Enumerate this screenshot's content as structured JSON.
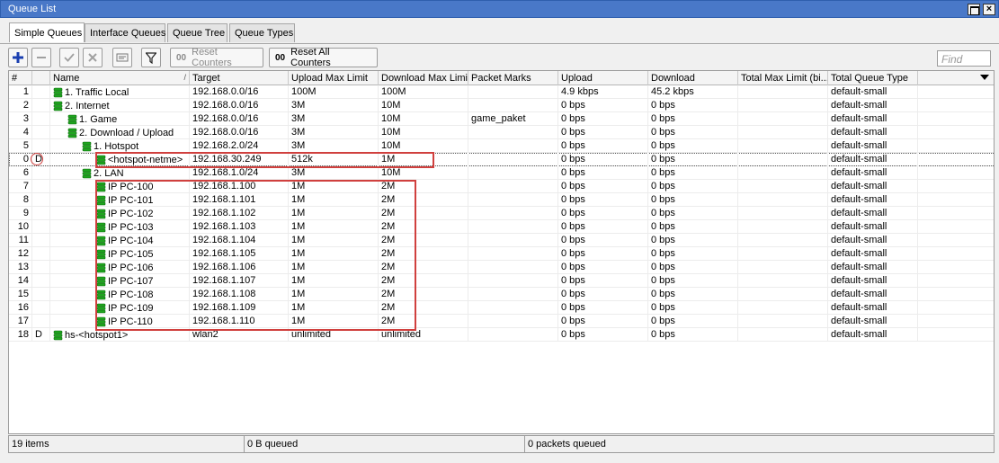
{
  "window": {
    "title": "Queue List"
  },
  "tabs": [
    {
      "label": "Simple Queues",
      "active": true
    },
    {
      "label": "Interface Queues",
      "active": false
    },
    {
      "label": "Queue Tree",
      "active": false
    },
    {
      "label": "Queue Types",
      "active": false
    }
  ],
  "toolbar": {
    "add_icon": "plus-icon",
    "remove_icon": "minus-icon",
    "enable_icon": "check-icon",
    "disable_icon": "x-icon",
    "comment_icon": "note-icon",
    "filter_icon": "filter-icon",
    "reset_counters_label": "Reset Counters",
    "reset_all_counters_label": "Reset All Counters",
    "counter_prefix": "00",
    "find_placeholder": "Find"
  },
  "columns": [
    "#",
    "Name",
    "Target",
    "Upload Max Limit",
    "Download Max Limit",
    "Packet Marks",
    "Upload",
    "Download",
    "Total Max Limit (bi...",
    "Total Queue Type"
  ],
  "sort_mark": "/",
  "rows": [
    {
      "num": "1",
      "flag": "",
      "level": 0,
      "name": "1. Traffic Local",
      "target": "192.168.0.0/16",
      "upmax": "100M",
      "downmax": "100M",
      "marks": "",
      "upload": "4.9 kbps",
      "download": "45.2 kbps",
      "totmax": "",
      "type": "default-small"
    },
    {
      "num": "2",
      "flag": "",
      "level": 0,
      "name": "2. Internet",
      "target": "192.168.0.0/16",
      "upmax": "3M",
      "downmax": "10M",
      "marks": "",
      "upload": "0 bps",
      "download": "0 bps",
      "totmax": "",
      "type": "default-small"
    },
    {
      "num": "3",
      "flag": "",
      "level": 1,
      "name": "1. Game",
      "target": "192.168.0.0/16",
      "upmax": "3M",
      "downmax": "10M",
      "marks": "game_paket",
      "upload": "0 bps",
      "download": "0 bps",
      "totmax": "",
      "type": "default-small"
    },
    {
      "num": "4",
      "flag": "",
      "level": 1,
      "name": "2. Download / Upload",
      "target": "192.168.0.0/16",
      "upmax": "3M",
      "downmax": "10M",
      "marks": "",
      "upload": "0 bps",
      "download": "0 bps",
      "totmax": "",
      "type": "default-small"
    },
    {
      "num": "5",
      "flag": "",
      "level": 2,
      "name": "1. Hotspot",
      "target": "192.168.2.0/24",
      "upmax": "3M",
      "downmax": "10M",
      "marks": "",
      "upload": "0 bps",
      "download": "0 bps",
      "totmax": "",
      "type": "default-small"
    },
    {
      "num": "0",
      "flag": "D",
      "level": 3,
      "name": "<hotspot-netme>",
      "target": "192.168.30.249",
      "upmax": "512k",
      "downmax": "1M",
      "marks": "",
      "upload": "0 bps",
      "download": "0 bps",
      "totmax": "",
      "type": "default-small",
      "selected": true
    },
    {
      "num": "6",
      "flag": "",
      "level": 2,
      "name": "2. LAN",
      "target": "192.168.1.0/24",
      "upmax": "3M",
      "downmax": "10M",
      "marks": "",
      "upload": "0 bps",
      "download": "0 bps",
      "totmax": "",
      "type": "default-small"
    },
    {
      "num": "7",
      "flag": "",
      "level": 3,
      "name": "IP PC-100",
      "target": "192.168.1.100",
      "upmax": "1M",
      "downmax": "2M",
      "marks": "",
      "upload": "0 bps",
      "download": "0 bps",
      "totmax": "",
      "type": "default-small"
    },
    {
      "num": "8",
      "flag": "",
      "level": 3,
      "name": "IP PC-101",
      "target": "192.168.1.101",
      "upmax": "1M",
      "downmax": "2M",
      "marks": "",
      "upload": "0 bps",
      "download": "0 bps",
      "totmax": "",
      "type": "default-small"
    },
    {
      "num": "9",
      "flag": "",
      "level": 3,
      "name": "IP PC-102",
      "target": "192.168.1.102",
      "upmax": "1M",
      "downmax": "2M",
      "marks": "",
      "upload": "0 bps",
      "download": "0 bps",
      "totmax": "",
      "type": "default-small"
    },
    {
      "num": "10",
      "flag": "",
      "level": 3,
      "name": "IP PC-103",
      "target": "192.168.1.103",
      "upmax": "1M",
      "downmax": "2M",
      "marks": "",
      "upload": "0 bps",
      "download": "0 bps",
      "totmax": "",
      "type": "default-small"
    },
    {
      "num": "11",
      "flag": "",
      "level": 3,
      "name": "IP PC-104",
      "target": "192.168.1.104",
      "upmax": "1M",
      "downmax": "2M",
      "marks": "",
      "upload": "0 bps",
      "download": "0 bps",
      "totmax": "",
      "type": "default-small"
    },
    {
      "num": "12",
      "flag": "",
      "level": 3,
      "name": "IP PC-105",
      "target": "192.168.1.105",
      "upmax": "1M",
      "downmax": "2M",
      "marks": "",
      "upload": "0 bps",
      "download": "0 bps",
      "totmax": "",
      "type": "default-small"
    },
    {
      "num": "13",
      "flag": "",
      "level": 3,
      "name": "IP PC-106",
      "target": "192.168.1.106",
      "upmax": "1M",
      "downmax": "2M",
      "marks": "",
      "upload": "0 bps",
      "download": "0 bps",
      "totmax": "",
      "type": "default-small"
    },
    {
      "num": "14",
      "flag": "",
      "level": 3,
      "name": "IP PC-107",
      "target": "192.168.1.107",
      "upmax": "1M",
      "downmax": "2M",
      "marks": "",
      "upload": "0 bps",
      "download": "0 bps",
      "totmax": "",
      "type": "default-small"
    },
    {
      "num": "15",
      "flag": "",
      "level": 3,
      "name": "IP PC-108",
      "target": "192.168.1.108",
      "upmax": "1M",
      "downmax": "2M",
      "marks": "",
      "upload": "0 bps",
      "download": "0 bps",
      "totmax": "",
      "type": "default-small"
    },
    {
      "num": "16",
      "flag": "",
      "level": 3,
      "name": "IP PC-109",
      "target": "192.168.1.109",
      "upmax": "1M",
      "downmax": "2M",
      "marks": "",
      "upload": "0 bps",
      "download": "0 bps",
      "totmax": "",
      "type": "default-small"
    },
    {
      "num": "17",
      "flag": "",
      "level": 3,
      "name": "IP PC-110",
      "target": "192.168.1.110",
      "upmax": "1M",
      "downmax": "2M",
      "marks": "",
      "upload": "0 bps",
      "download": "0 bps",
      "totmax": "",
      "type": "default-small"
    },
    {
      "num": "18",
      "flag": "D",
      "level": 0,
      "name": "hs-<hotspot1>",
      "target": "wlan2",
      "upmax": "unlimited",
      "downmax": "unlimited",
      "marks": "",
      "upload": "0 bps",
      "download": "0 bps",
      "totmax": "",
      "type": "default-small"
    }
  ],
  "status": {
    "items": "19 items",
    "queued": "0 B queued",
    "packets": "0 packets queued"
  },
  "colors": {
    "titlebar": "#4978c8",
    "queue_icon": "#1fa51f",
    "annotation": "#d0403e"
  }
}
